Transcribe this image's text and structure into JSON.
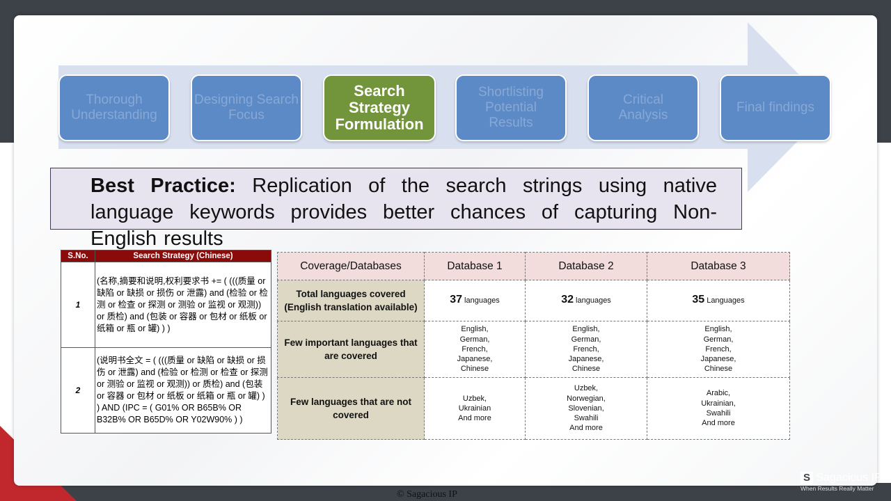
{
  "process_steps": [
    {
      "label": "Thorough Understanding",
      "active": false
    },
    {
      "label": "Designing Search Focus",
      "active": false
    },
    {
      "label": "Search Strategy Formulation",
      "active": true
    },
    {
      "label": "Shortlisting Potential Results",
      "active": false
    },
    {
      "label": "Critical Analysis",
      "active": false
    },
    {
      "label": "Final findings",
      "active": false
    }
  ],
  "best_practice": {
    "lead": "Best Practice:",
    "text": " Replication of the search strings using native language keywords provides better chances of capturing Non-English results"
  },
  "strategy_table": {
    "headers": [
      "S.No.",
      "Search Strategy (Chinese)"
    ],
    "rows": [
      {
        "sno": "1",
        "strategy": "(名称,摘要和说明,权利要求书 += ( (((质量 or 缺陷 or 缺损 or 损伤 or 泄露) and (检验 or 检测 or 检查 or 探测 or 测验 or 监视 or 观测)) or 质检) and (包装 or 容器 or 包材 or 纸板 or 纸箱 or 瓶 or 罐) ) )"
      },
      {
        "sno": "2",
        "strategy": " (说明书全文 = ( (((质量 or 缺陷 or 缺损 or 损伤 or 泄露) and (检验 or 检测 or 检查 or 探测 or 测验 or 监视 or 观测)) or 质检) and (包装 or 容器 or 包材 or 纸板 or 纸箱 or 瓶 or 罐) ) ) AND (IPC = ( G01% OR B65B% OR B32B% OR B65D% OR Y02W90% ) )"
      }
    ]
  },
  "coverage_table": {
    "headers": [
      "Coverage/Databases",
      "Database 1",
      "Database 2",
      "Database 3"
    ],
    "rows": [
      {
        "label": "Total languages covered (English translation available)",
        "cells": [
          {
            "num": "37",
            "unit": " languages"
          },
          {
            "num": "32",
            "unit": " languages"
          },
          {
            "num": "35",
            "unit": " Languages"
          }
        ]
      },
      {
        "label": "Few important languages that are covered",
        "cells": [
          [
            "English,",
            "German,",
            "French,",
            "Japanese,",
            "Chinese"
          ],
          [
            "English,",
            "German,",
            "French,",
            "Japanese,",
            "Chinese"
          ],
          [
            "English,",
            "German,",
            "French,",
            "Japanese,",
            "Chinese"
          ]
        ]
      },
      {
        "label": "Few languages that are not covered",
        "cells": [
          [
            "Uzbek,",
            "Ukrainian",
            "And more"
          ],
          [
            "Uzbek,",
            "Norwegian,",
            "Slovenian,",
            "Swahili",
            "And more"
          ],
          [
            "Arabic,",
            "Ukrainian,",
            "Swahili",
            "And more"
          ]
        ]
      }
    ]
  },
  "footer": {
    "copyright": "© Sagacious  IP",
    "brand_mark": "S",
    "brand_name": "Sagacious IP",
    "brand_tagline": "When Results Really Matter"
  }
}
